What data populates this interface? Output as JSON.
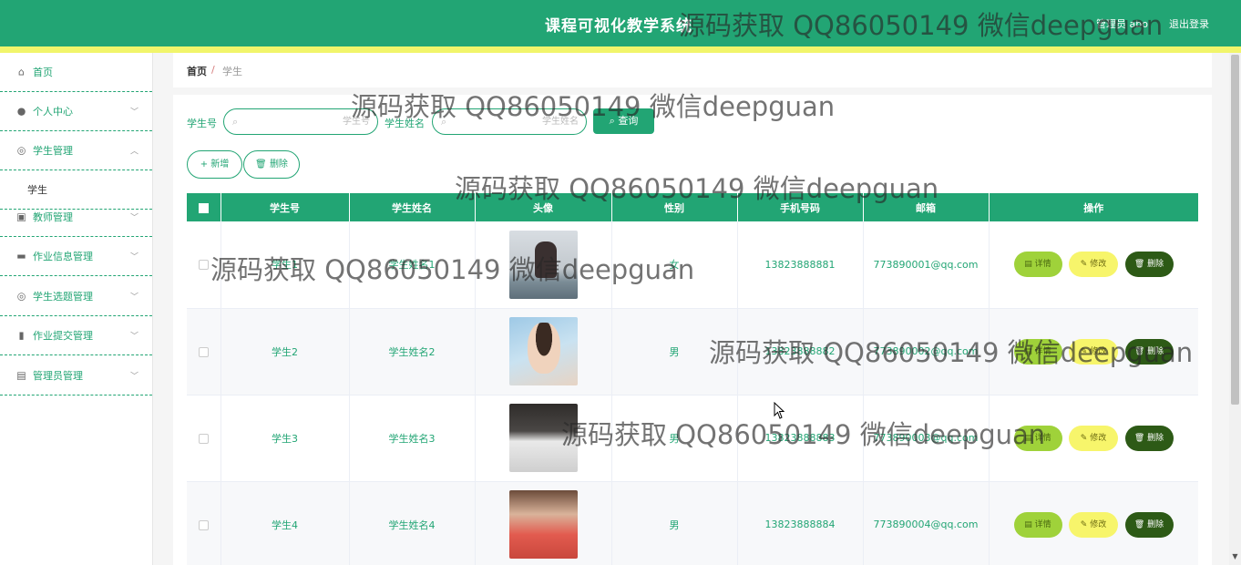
{
  "header": {
    "title": "课程可视化教学系统",
    "user": "管理员 abo",
    "logout": "退出登录"
  },
  "sidebar": {
    "items": [
      {
        "label": "首页",
        "icon": "home-icon",
        "glyph": "⌂",
        "arrow": ""
      },
      {
        "label": "个人中心",
        "icon": "user-icon",
        "glyph": "●",
        "arrow": "﹀"
      },
      {
        "label": "学生管理",
        "icon": "compass-icon",
        "glyph": "◎",
        "arrow": "︿"
      },
      {
        "label": "教师管理",
        "icon": "clipboard-icon",
        "glyph": "▣",
        "arrow": "﹀"
      },
      {
        "label": "作业信息管理",
        "icon": "briefcase-icon",
        "glyph": "▬",
        "arrow": "﹀"
      },
      {
        "label": "学生选题管理",
        "icon": "compass-icon",
        "glyph": "◎",
        "arrow": "﹀"
      },
      {
        "label": "作业提交管理",
        "icon": "book-icon",
        "glyph": "▮",
        "arrow": "﹀"
      },
      {
        "label": "管理员管理",
        "icon": "suitcase-icon",
        "glyph": "▤",
        "arrow": "﹀"
      }
    ],
    "submenu": {
      "label": "学生"
    }
  },
  "breadcrumb": {
    "home": "首页",
    "sep": "/",
    "current": "学生"
  },
  "search": {
    "student_no_label": "学生号",
    "student_no_placeholder": "学生号",
    "student_name_label": "学生姓名",
    "student_name_placeholder": "学生姓名",
    "query_label": "查询",
    "search_glyph": "⌕"
  },
  "actions": {
    "add_label": "+ 新增",
    "delete_label": "删除"
  },
  "table": {
    "columns": [
      "学生号",
      "学生姓名",
      "头像",
      "性别",
      "手机号码",
      "邮箱",
      "操作"
    ],
    "rows": [
      {
        "no": "学生1",
        "name": "学生姓名1",
        "gender": "女",
        "phone": "13823888881",
        "email": "773890001@qq.com"
      },
      {
        "no": "学生2",
        "name": "学生姓名2",
        "gender": "男",
        "phone": "13823888882",
        "email": "773890002@qq.com"
      },
      {
        "no": "学生3",
        "name": "学生姓名3",
        "gender": "男",
        "phone": "13823888883",
        "email": "773890003@qq.com"
      },
      {
        "no": "学生4",
        "name": "学生姓名4",
        "gender": "男",
        "phone": "13823888884",
        "email": "773890004@qq.com"
      }
    ],
    "ops": {
      "detail": "详情",
      "edit": "修改",
      "delete": "删除"
    }
  },
  "watermark_text": "源码获取 QQ86050149 微信deepguan",
  "colors": {
    "primary": "#22a574",
    "accent_bar": "#f1f56b",
    "detail": "#9fd23a",
    "edit": "#f7f56b",
    "delete": "#2d5a16"
  }
}
